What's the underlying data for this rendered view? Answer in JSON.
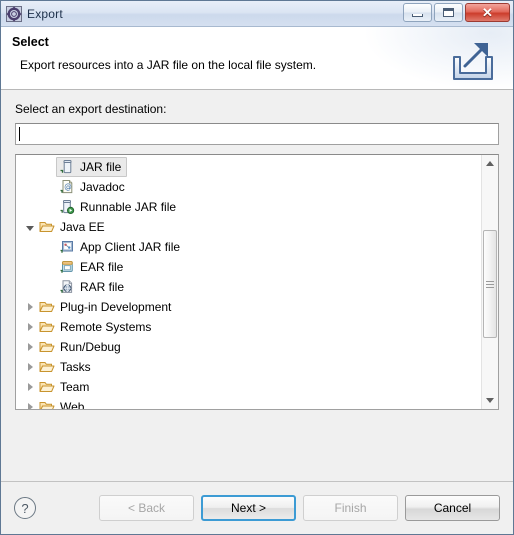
{
  "window": {
    "title": "Export",
    "icon": "export-wizard-icon",
    "controls": {
      "minimize": "minimize-button",
      "maximize": "maximize-button",
      "close_glyph": "✕"
    }
  },
  "header": {
    "title": "Select",
    "description": "Export resources into a JAR file on the local file system.",
    "icon": "export-banner-icon"
  },
  "body": {
    "destination_label": "Select an export destination:",
    "filter": {
      "value": "",
      "placeholder": ""
    }
  },
  "tree": {
    "rows": [
      {
        "label": "JAR file",
        "icon": "jar-file-icon",
        "indent": 2,
        "twisty": "none",
        "selected": true
      },
      {
        "label": "Javadoc",
        "icon": "javadoc-icon",
        "indent": 2,
        "twisty": "none",
        "selected": false
      },
      {
        "label": "Runnable JAR file",
        "icon": "runnable-jar-icon",
        "indent": 2,
        "twisty": "none",
        "selected": false
      },
      {
        "label": "Java EE",
        "icon": "folder-open-icon",
        "indent": 1,
        "twisty": "expanded",
        "selected": false
      },
      {
        "label": "App Client JAR file",
        "icon": "app-client-jar-icon",
        "indent": 2,
        "twisty": "none",
        "selected": false
      },
      {
        "label": "EAR file",
        "icon": "ear-file-icon",
        "indent": 2,
        "twisty": "none",
        "selected": false
      },
      {
        "label": "RAR file",
        "icon": "rar-file-icon",
        "indent": 2,
        "twisty": "none",
        "selected": false
      },
      {
        "label": "Plug-in Development",
        "icon": "folder-open-icon",
        "indent": 1,
        "twisty": "collapsed",
        "selected": false
      },
      {
        "label": "Remote Systems",
        "icon": "folder-open-icon",
        "indent": 1,
        "twisty": "collapsed",
        "selected": false
      },
      {
        "label": "Run/Debug",
        "icon": "folder-open-icon",
        "indent": 1,
        "twisty": "collapsed",
        "selected": false
      },
      {
        "label": "Tasks",
        "icon": "folder-open-icon",
        "indent": 1,
        "twisty": "collapsed",
        "selected": false
      },
      {
        "label": "Team",
        "icon": "folder-open-icon",
        "indent": 1,
        "twisty": "collapsed",
        "selected": false
      },
      {
        "label": "Web",
        "icon": "folder-open-icon",
        "indent": 1,
        "twisty": "collapsed",
        "selected": false
      }
    ],
    "scrollbar": {
      "up_arrow": "scroll-up-arrow",
      "down_arrow": "scroll-down-arrow"
    }
  },
  "footer": {
    "help_glyph": "?",
    "buttons": [
      {
        "label": "< Back",
        "state": "disabled"
      },
      {
        "label": "Next >",
        "state": "focused"
      },
      {
        "label": "Finish",
        "state": "disabled"
      },
      {
        "label": "Cancel",
        "state": "normal"
      }
    ]
  },
  "colors": {
    "accent_blue": "#3c9bd4",
    "close_red": "#cc3d2c",
    "folder_orange": "#e8a33d",
    "body_gray": "#f0f0f0",
    "titlebar_blue": "#dbe5f3"
  }
}
